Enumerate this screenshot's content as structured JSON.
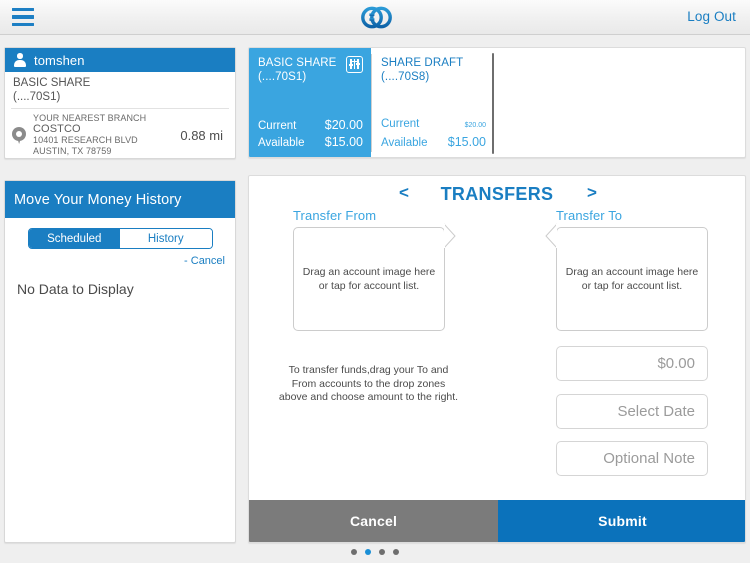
{
  "topbar": {
    "menu_icon": "hamburger-menu-icon",
    "logo_icon": "credit-union-logo-icon",
    "logout_label": "Log Out"
  },
  "account_panel": {
    "user_icon": "person-icon",
    "username": "tomshen",
    "account_name": "BASIC SHARE",
    "account_number": "(....70S1)",
    "branch": {
      "pin_icon": "map-pin-icon",
      "heading": "YOUR NEAREST BRANCH",
      "name": "COSTCO",
      "street": "10401 RESEARCH BLVD",
      "city_state_zip": "AUSTIN, TX 78759",
      "distance": "0.88 mi"
    }
  },
  "history_panel": {
    "title": "Move Your Money History",
    "segments": [
      {
        "label": "Scheduled",
        "active": true
      },
      {
        "label": "History",
        "active": false
      }
    ],
    "cancel_label": "- Cancel",
    "empty_message": "No Data to Display"
  },
  "account_cards": [
    {
      "title": "BASIC SHARE",
      "number": "(....70S1)",
      "selected": true,
      "icon": "equalizer-settings-icon",
      "current_label": "Current",
      "current_value": "$20.00",
      "available_label": "Available",
      "available_value": "$15.00"
    },
    {
      "title": "SHARE DRAFT",
      "number": "(....70S8)",
      "selected": false,
      "current_label": "Current",
      "current_value": "$20.00",
      "available_label": "Available",
      "available_value": "$15.00"
    }
  ],
  "transfers": {
    "title": "TRANSFERS",
    "prev_arrow": "<",
    "next_arrow": ">",
    "from_label": "Transfer From",
    "to_label": "Transfer To",
    "dropzone_text": "Drag an account image here or tap for account list.",
    "instructions": "To transfer funds,drag your To and From accounts to the drop zones above and choose amount to the right.",
    "amount_placeholder": "$0.00",
    "date_placeholder": "Select Date",
    "note_placeholder": "Optional Note",
    "cancel_label": "Cancel",
    "submit_label": "Submit"
  },
  "pagination": {
    "total": 4,
    "active_index": 1
  },
  "colors": {
    "brand_blue": "#1a7ec2",
    "light_blue": "#3aa5e0",
    "submit_blue": "#0b72bb",
    "cancel_gray": "#7b7b7b"
  }
}
